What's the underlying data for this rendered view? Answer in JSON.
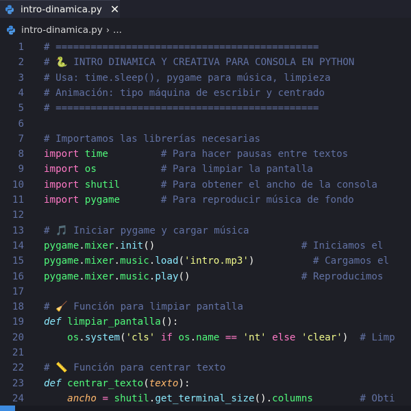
{
  "tab": {
    "label": "intro-dinamica.py",
    "close_glyph": "✕"
  },
  "breadcrumb": {
    "file": "intro-dinamica.py",
    "separator": "›",
    "more": "..."
  },
  "colors": {
    "background": "#1e1f26",
    "comment": "#6272a4",
    "keyword": "#ff79c6",
    "function": "#50fa7b",
    "string": "#f1fa8c",
    "attribute": "#8be9fd",
    "accent": "#3d8be0"
  },
  "lines": [
    {
      "n": "1",
      "tokens": [
        [
          "comment",
          "# ============================================="
        ]
      ]
    },
    {
      "n": "2",
      "tokens": [
        [
          "comment",
          "# "
        ],
        [
          "emoji",
          "🐍"
        ],
        [
          "comment",
          " INTRO DINAMICA Y CREATIVA PARA CONSOLA EN PYTHON"
        ]
      ]
    },
    {
      "n": "3",
      "tokens": [
        [
          "comment",
          "# Usa: time.sleep(), pygame para música, limpieza"
        ]
      ]
    },
    {
      "n": "4",
      "tokens": [
        [
          "comment",
          "# Animación: tipo máquina de escribir y centrado"
        ]
      ]
    },
    {
      "n": "5",
      "tokens": [
        [
          "comment",
          "# ============================================="
        ]
      ]
    },
    {
      "n": "6",
      "tokens": []
    },
    {
      "n": "7",
      "tokens": [
        [
          "comment",
          "# Importamos las librerías necesarias"
        ]
      ]
    },
    {
      "n": "8",
      "tokens": [
        [
          "keyword",
          "import"
        ],
        [
          "text",
          " "
        ],
        [
          "func",
          "time"
        ],
        [
          "text",
          "         "
        ],
        [
          "comment",
          "# Para hacer pausas entre textos"
        ]
      ]
    },
    {
      "n": "9",
      "tokens": [
        [
          "keyword",
          "import"
        ],
        [
          "text",
          " "
        ],
        [
          "func",
          "os"
        ],
        [
          "text",
          "           "
        ],
        [
          "comment",
          "# Para limpiar la pantalla"
        ]
      ]
    },
    {
      "n": "10",
      "tokens": [
        [
          "keyword",
          "import"
        ],
        [
          "text",
          " "
        ],
        [
          "func",
          "shutil"
        ],
        [
          "text",
          "       "
        ],
        [
          "comment",
          "# Para obtener el ancho de la consola"
        ]
      ]
    },
    {
      "n": "11",
      "tokens": [
        [
          "keyword",
          "import"
        ],
        [
          "text",
          " "
        ],
        [
          "func",
          "pygame"
        ],
        [
          "text",
          "       "
        ],
        [
          "comment",
          "# Para reproducir música de fondo"
        ]
      ]
    },
    {
      "n": "12",
      "tokens": []
    },
    {
      "n": "13",
      "tokens": [
        [
          "comment",
          "# "
        ],
        [
          "emoji",
          "🎵"
        ],
        [
          "comment",
          " Iniciar pygame y cargar música"
        ]
      ]
    },
    {
      "n": "14",
      "tokens": [
        [
          "func",
          "pygame"
        ],
        [
          "text",
          "."
        ],
        [
          "func",
          "mixer"
        ],
        [
          "text",
          "."
        ],
        [
          "attr",
          "init"
        ],
        [
          "text",
          "()"
        ],
        [
          "text",
          "                         "
        ],
        [
          "comment",
          "# Iniciamos el"
        ]
      ]
    },
    {
      "n": "15",
      "tokens": [
        [
          "func",
          "pygame"
        ],
        [
          "text",
          "."
        ],
        [
          "func",
          "mixer"
        ],
        [
          "text",
          "."
        ],
        [
          "func",
          "music"
        ],
        [
          "text",
          "."
        ],
        [
          "attr",
          "load"
        ],
        [
          "text",
          "("
        ],
        [
          "str",
          "'intro.mp3'"
        ],
        [
          "text",
          ")"
        ],
        [
          "text",
          "          "
        ],
        [
          "comment",
          "# Cargamos el"
        ]
      ]
    },
    {
      "n": "16",
      "tokens": [
        [
          "func",
          "pygame"
        ],
        [
          "text",
          "."
        ],
        [
          "func",
          "mixer"
        ],
        [
          "text",
          "."
        ],
        [
          "func",
          "music"
        ],
        [
          "text",
          "."
        ],
        [
          "attr",
          "play"
        ],
        [
          "text",
          "()"
        ],
        [
          "text",
          "                   "
        ],
        [
          "comment",
          "# Reproducimos"
        ]
      ]
    },
    {
      "n": "17",
      "tokens": []
    },
    {
      "n": "18",
      "tokens": [
        [
          "comment",
          "# "
        ],
        [
          "emoji",
          "🧹"
        ],
        [
          "comment",
          " Función para limpiar pantalla"
        ]
      ]
    },
    {
      "n": "19",
      "tokens": [
        [
          "def",
          "def"
        ],
        [
          "text",
          " "
        ],
        [
          "defname",
          "limpiar_pantalla"
        ],
        [
          "text",
          "():"
        ]
      ]
    },
    {
      "n": "20",
      "tokens": [
        [
          "text",
          "    "
        ],
        [
          "func",
          "os"
        ],
        [
          "text",
          "."
        ],
        [
          "attr",
          "system"
        ],
        [
          "text",
          "("
        ],
        [
          "str",
          "'cls'"
        ],
        [
          "text",
          " "
        ],
        [
          "keyword",
          "if"
        ],
        [
          "text",
          " "
        ],
        [
          "func",
          "os"
        ],
        [
          "text",
          "."
        ],
        [
          "func",
          "name"
        ],
        [
          "text",
          " "
        ],
        [
          "op",
          "=="
        ],
        [
          "text",
          " "
        ],
        [
          "str",
          "'nt'"
        ],
        [
          "text",
          " "
        ],
        [
          "keyword",
          "else"
        ],
        [
          "text",
          " "
        ],
        [
          "str",
          "'clear'"
        ],
        [
          "text",
          ")  "
        ],
        [
          "comment",
          "# Limp"
        ]
      ]
    },
    {
      "n": "21",
      "tokens": []
    },
    {
      "n": "22",
      "tokens": [
        [
          "comment",
          "# "
        ],
        [
          "emoji",
          "📏"
        ],
        [
          "comment",
          " Función para centrar texto"
        ]
      ]
    },
    {
      "n": "23",
      "tokens": [
        [
          "def",
          "def"
        ],
        [
          "text",
          " "
        ],
        [
          "defname",
          "centrar_texto"
        ],
        [
          "text",
          "("
        ],
        [
          "param",
          "texto"
        ],
        [
          "text",
          "):"
        ]
      ]
    },
    {
      "n": "24",
      "tokens": [
        [
          "text",
          "    "
        ],
        [
          "param",
          "ancho"
        ],
        [
          "text",
          " "
        ],
        [
          "op",
          "="
        ],
        [
          "text",
          " "
        ],
        [
          "func",
          "shutil"
        ],
        [
          "text",
          "."
        ],
        [
          "attr",
          "get_terminal_size"
        ],
        [
          "text",
          "()."
        ],
        [
          "func",
          "columns"
        ],
        [
          "text",
          "        "
        ],
        [
          "comment",
          "# Obti"
        ]
      ]
    }
  ]
}
